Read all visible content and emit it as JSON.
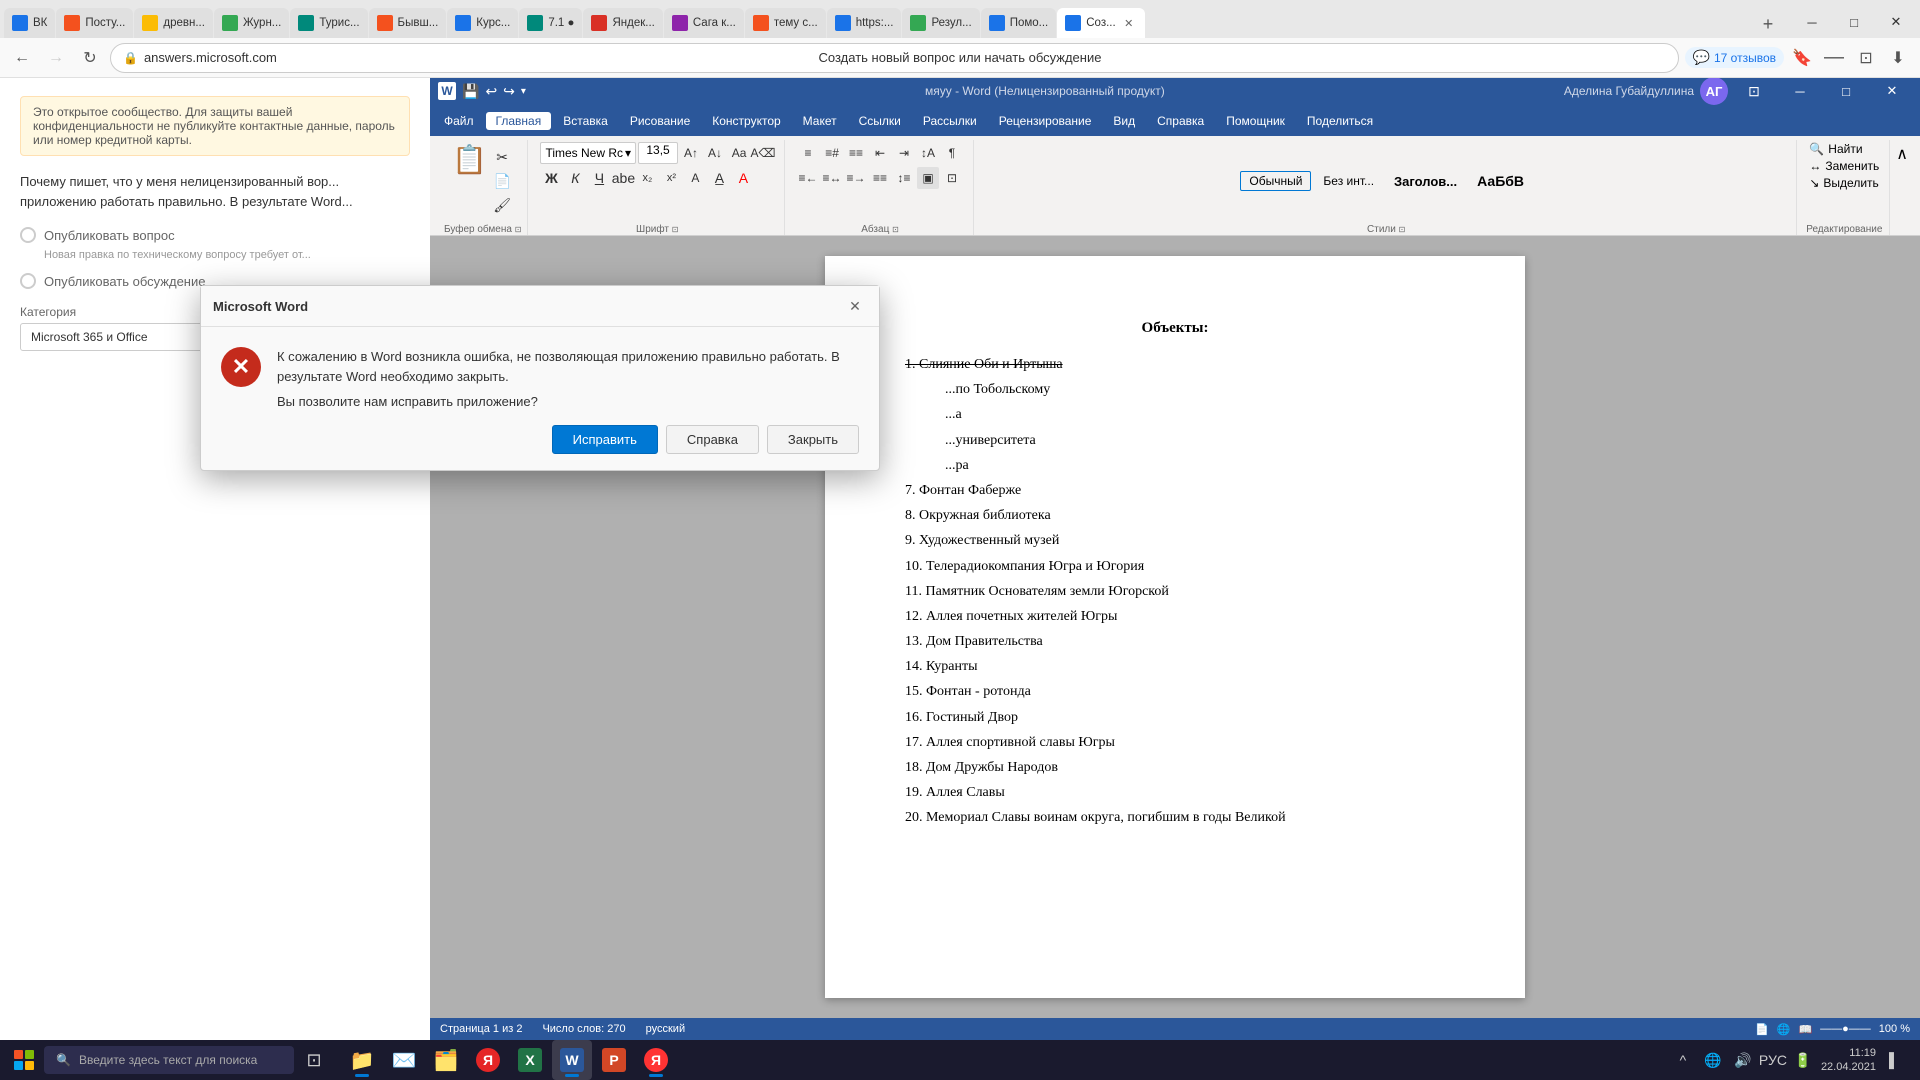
{
  "browser": {
    "nav_title": "Создать новый вопрос или начать обсуждение",
    "address": "answers.microsoft.com",
    "reviews_badge": "17 отзывов",
    "tabs": [
      {
        "label": "ВК",
        "active": false,
        "color": "fav-blue"
      },
      {
        "label": "Посту...",
        "active": false,
        "color": "fav-orange"
      },
      {
        "label": "древн...",
        "active": false,
        "color": "fav-yellow"
      },
      {
        "label": "Журн...",
        "active": false,
        "color": "fav-green"
      },
      {
        "label": "Туриc...",
        "active": false,
        "color": "fav-teal"
      },
      {
        "label": "Бывш...",
        "active": false,
        "color": "fav-orange"
      },
      {
        "label": "Курс...",
        "active": false,
        "color": "fav-blue"
      },
      {
        "label": "7.1 ●",
        "active": false,
        "color": "fav-teal"
      },
      {
        "label": "Яндек...",
        "active": false,
        "color": "fav-red"
      },
      {
        "label": "Сага к...",
        "active": false,
        "color": "fav-purple"
      },
      {
        "label": "тему с...",
        "active": false,
        "color": "fav-orange"
      },
      {
        "label": "https:...",
        "active": false,
        "color": "fav-blue"
      },
      {
        "label": "Резул...",
        "active": false,
        "color": "fav-green"
      },
      {
        "label": "Помо...",
        "active": false,
        "color": "fav-blue"
      },
      {
        "label": "Соз...",
        "active": true,
        "color": "fav-blue"
      }
    ]
  },
  "word": {
    "title": "мяуу - Word (Нелицензированный продукт)",
    "user": "Аделина Губайдуллина",
    "menu": [
      "Файл",
      "Главная",
      "Вставка",
      "Рисование",
      "Конструктор",
      "Макет",
      "Ссылки",
      "Рассылки",
      "Рецензирование",
      "Вид",
      "Справка",
      "Помощник",
      "Поделиться"
    ],
    "active_menu": "Главная",
    "font_name": "Times New Rc",
    "font_size": "13,5",
    "status_page": "Страница 1 из 2",
    "status_words": "Число слов: 270",
    "status_lang": "русский",
    "status_zoom": "100 %"
  },
  "document": {
    "title": "Объекты:",
    "items": [
      "1.  Слияние Оби и Иртыша",
      "...  (тобольскому)",
      "...  а",
      "...  университета",
      "...  ра",
      "7.   Фонтан Фаберже",
      "8.   Окружная библиотека",
      "9.   Художественный музей",
      "10. Телерадиокомпания Югра и Югория",
      "11. Памятник Основателям земли Югорской",
      "12. Аллея почетных жителей Югры",
      "13. Дом Правительства",
      "14. Куранты",
      "15. Фонтан - ротонда",
      "16. Гостиный Двор",
      "17. Аллея спортивной славы Югры",
      "18. Дом Дружбы Народов",
      "19. Аллея Славы",
      "20. Мемориал Славы воинам округа, погибшим в годы Великой"
    ]
  },
  "dialog": {
    "title": "Microsoft Word",
    "message": "К сожалению в Word возникла ошибка, не позволяющая приложению правильно работать. В результате Word необходимо закрыть.",
    "question": "Вы позволите нам исправить приложение?",
    "btn_fix": "Исправить",
    "btn_help": "Справка",
    "btn_close": "Закрыть"
  },
  "page_left": {
    "notice": "Это открытое сообщество. Для защиты вашей конфиденциальности не публикуйте контактные данные, пароль или номер кредитной карты.",
    "question_text": "Почему пишет, что у меня нелицензированный вор... приложению работать правильно. В результате Word..."
  },
  "taskbar": {
    "search_placeholder": "Введите здесь текст для поиска",
    "clock_time": "11:19",
    "clock_date": "22.04.2021",
    "lang": "РУС",
    "apps": [
      {
        "icon": "🗂️",
        "label": "File Explorer"
      },
      {
        "icon": "✉️",
        "label": "Mail"
      },
      {
        "icon": "📁",
        "label": "Folder"
      },
      {
        "icon": "🔍",
        "label": "Search Yandex"
      },
      {
        "icon": "📊",
        "label": "Excel"
      },
      {
        "icon": "📝",
        "label": "Word"
      },
      {
        "icon": "📊",
        "label": "PowerPoint"
      },
      {
        "icon": "🌐",
        "label": "Yandex Browser"
      }
    ]
  }
}
